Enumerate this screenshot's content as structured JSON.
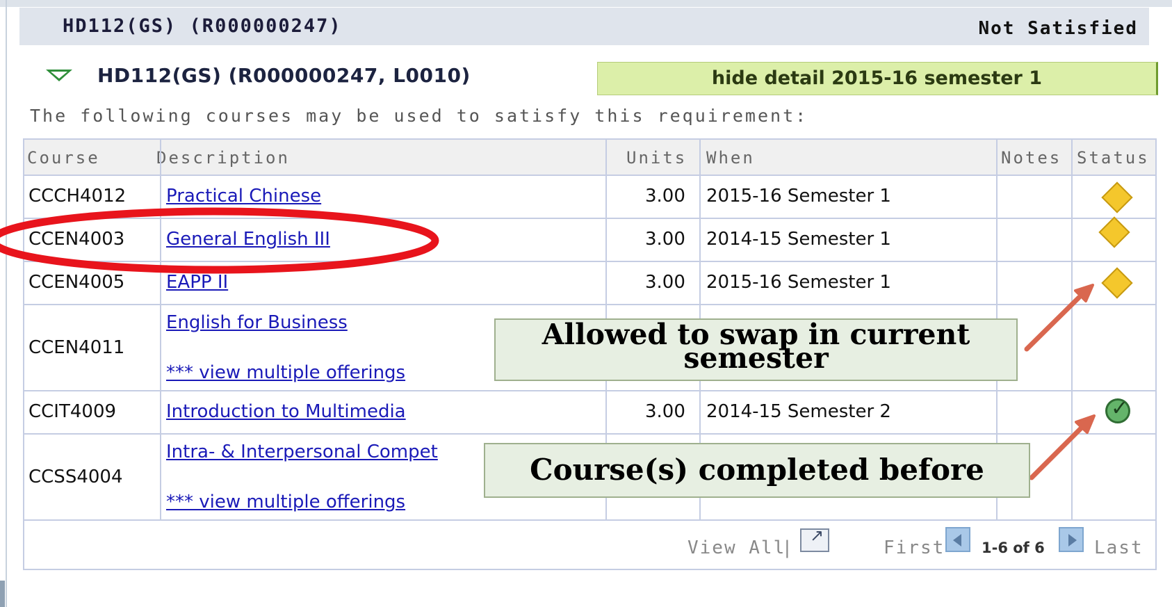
{
  "requirement": {
    "title": "HD112(GS) (R000000247)",
    "status": "Not Satisfied"
  },
  "line": {
    "title": "HD112(GS) (R000000247, L0010)",
    "hide_detail": "hide detail 2015-16 semester 1",
    "intro": "The following courses may be used to satisfy this requirement:"
  },
  "table": {
    "headers": [
      "Course",
      "Description",
      "Units",
      "When",
      "Notes",
      "Status"
    ],
    "rows": [
      {
        "course": "CCCH4012",
        "description": "Practical Chinese",
        "units": "3.00",
        "when": "2015-16 Semester 1",
        "status": "in-progress-diamond-icon"
      },
      {
        "course": "CCEN4003",
        "description": "General English III",
        "units": "3.00",
        "when": "2014-15 Semester 1",
        "status": "in-progress-diamond-icon"
      },
      {
        "course": "CCEN4005",
        "description": "EAPP II",
        "units": "3.00",
        "when": "2015-16 Semester 1",
        "status": "in-progress-diamond-icon"
      },
      {
        "course": "CCEN4011",
        "description": "English for Business",
        "extra": "*** view multiple offerings",
        "units": "",
        "when": "",
        "status": ""
      },
      {
        "course": "CCIT4009",
        "description": "Introduction to Multimedia",
        "units": "3.00",
        "when": "2014-15 Semester 2",
        "status": "completed-check-icon"
      },
      {
        "course": "CCSS4004",
        "description": "Intra- & Interpersonal Compet",
        "extra": "*** view multiple offerings",
        "units": "",
        "when": "",
        "status": ""
      }
    ]
  },
  "pager": {
    "view_all": "View All",
    "separator": "|",
    "first": "First",
    "range": "1-6 of 6",
    "last": "Last"
  },
  "annotations": {
    "swap_line1": "Allowed to swap in current",
    "swap_line2": "semester",
    "completed": "Course(s) completed before"
  },
  "colors": {
    "highlight_ellipse": "#e8141c",
    "arrow": "#d9674f",
    "hide_detail_bg": "#dcefa9",
    "link": "#1a1ab8"
  }
}
